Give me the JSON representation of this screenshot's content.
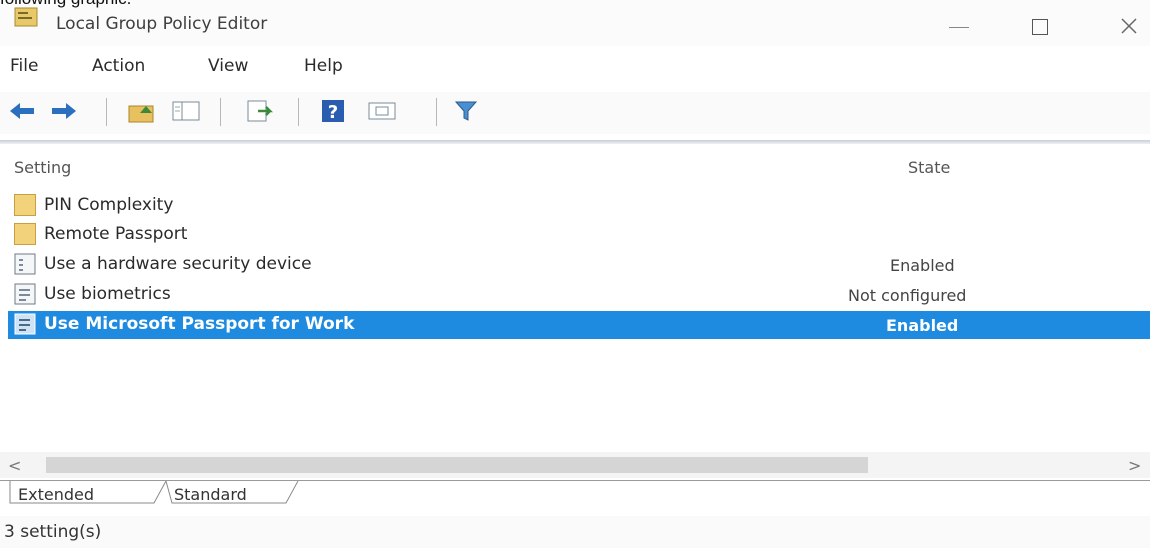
{
  "caption": "following graphic.",
  "window": {
    "title": "Local Group Policy Editor",
    "app_icon": "group-policy-icon",
    "controls": [
      "minimize",
      "maximize",
      "close"
    ]
  },
  "menu": {
    "file": "File",
    "action": "Action",
    "view": "View",
    "help": "Help"
  },
  "toolbar": {
    "icons": [
      "back-arrow-icon",
      "forward-arrow-icon",
      "up-folder-icon",
      "show-hide-tree-icon",
      "export-list-icon",
      "help-icon",
      "properties-icon",
      "filter-icon"
    ]
  },
  "list": {
    "columns": {
      "setting": "Setting",
      "state": "State"
    },
    "rows": [
      {
        "icon": "folder-icon",
        "setting": "PIN Complexity",
        "state": ""
      },
      {
        "icon": "folder-icon",
        "setting": "Remote Passport",
        "state": ""
      },
      {
        "icon": "policy-setting-icon",
        "setting": "Use a hardware security device",
        "state": "Enabled"
      },
      {
        "icon": "policy-setting-icon",
        "setting": "Use biometrics",
        "state": "Not configured"
      },
      {
        "icon": "policy-setting-icon",
        "setting": "Use Microsoft Passport for Work",
        "state": "Enabled",
        "selected": true
      }
    ]
  },
  "scrollbar": {
    "left_arrow": "<",
    "right_arrow": ">"
  },
  "tabs": {
    "extended": "Extended",
    "standard": "Standard",
    "active": "Standard"
  },
  "status": {
    "text": "3 setting(s)"
  },
  "colors": {
    "selection": "#1e8be0",
    "folder": "#f2d27a"
  }
}
